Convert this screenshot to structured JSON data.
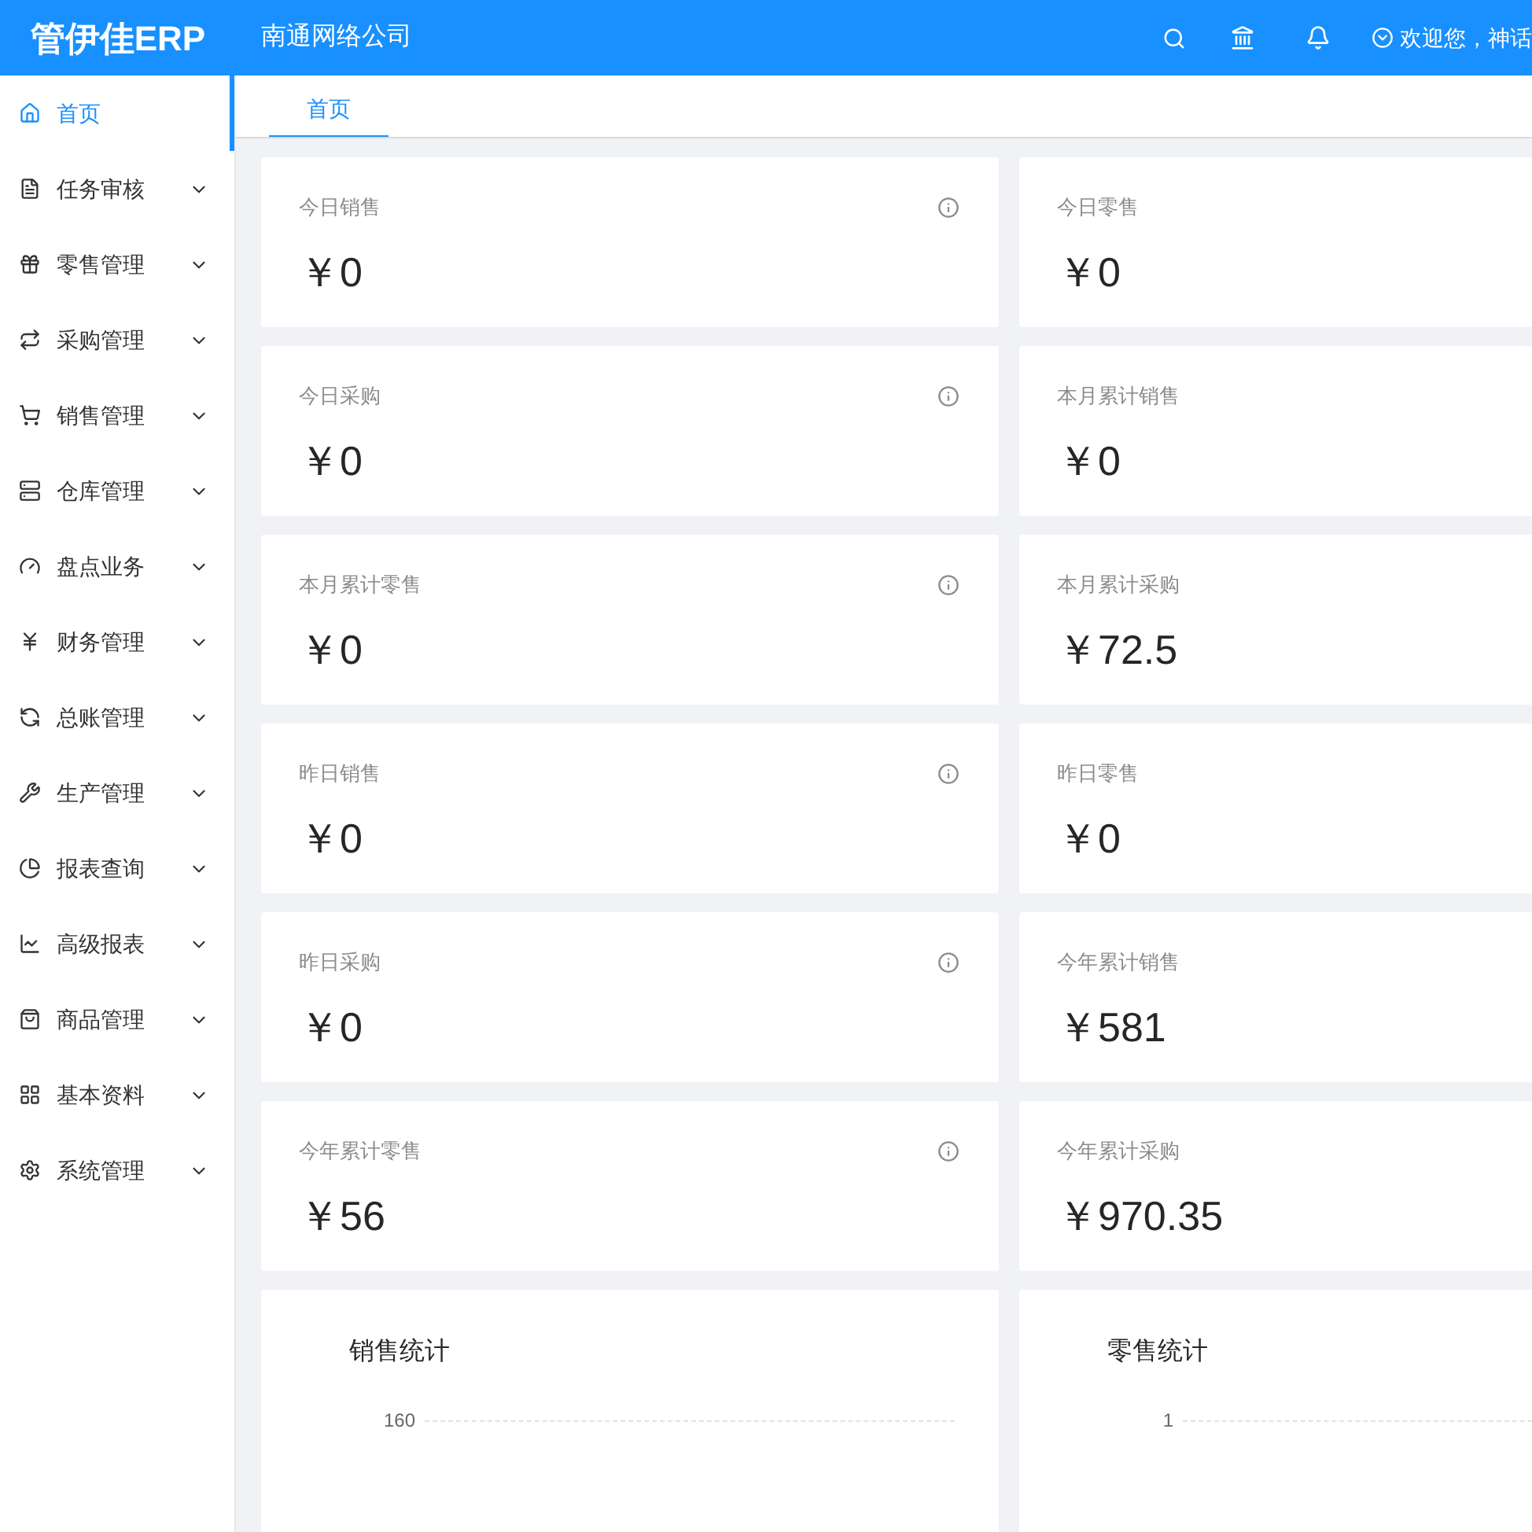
{
  "header": {
    "logo": "管伊佳ERP",
    "company": "南通网络公司",
    "welcome": "欢迎您，神话"
  },
  "sidebar": {
    "items": [
      {
        "label": "首页",
        "kind": "link",
        "selected": true
      },
      {
        "label": "任务审核",
        "kind": "group",
        "selected": false
      },
      {
        "label": "零售管理",
        "kind": "group",
        "selected": false
      },
      {
        "label": "采购管理",
        "kind": "group",
        "selected": false
      },
      {
        "label": "销售管理",
        "kind": "group",
        "selected": false
      },
      {
        "label": "仓库管理",
        "kind": "group",
        "selected": false
      },
      {
        "label": "盘点业务",
        "kind": "group",
        "selected": false
      },
      {
        "label": "财务管理",
        "kind": "group",
        "selected": false
      },
      {
        "label": "总账管理",
        "kind": "group",
        "selected": false
      },
      {
        "label": "生产管理",
        "kind": "group",
        "selected": false
      },
      {
        "label": "报表查询",
        "kind": "group",
        "selected": false
      },
      {
        "label": "高级报表",
        "kind": "group",
        "selected": false
      },
      {
        "label": "商品管理",
        "kind": "group",
        "selected": false
      },
      {
        "label": "基本资料",
        "kind": "group",
        "selected": false
      },
      {
        "label": "系统管理",
        "kind": "group",
        "selected": false
      }
    ]
  },
  "tabs": [
    {
      "label": "首页",
      "selected": true
    }
  ],
  "stats": [
    {
      "label": "今日销售",
      "value": "￥0",
      "info": true
    },
    {
      "label": "今日零售",
      "value": "￥0",
      "info": false
    },
    {
      "label": "今日采购",
      "value": "￥0",
      "info": true
    },
    {
      "label": "本月累计销售",
      "value": "￥0",
      "info": false
    },
    {
      "label": "本月累计零售",
      "value": "￥0",
      "info": true
    },
    {
      "label": "本月累计采购",
      "value": "￥72.5",
      "info": false
    },
    {
      "label": "昨日销售",
      "value": "￥0",
      "info": true
    },
    {
      "label": "昨日零售",
      "value": "￥0",
      "info": false
    },
    {
      "label": "昨日采购",
      "value": "￥0",
      "info": true
    },
    {
      "label": "今年累计销售",
      "value": "￥581",
      "info": false
    },
    {
      "label": "今年累计零售",
      "value": "￥56",
      "info": true
    },
    {
      "label": "今年累计采购",
      "value": "￥970.35",
      "info": false
    }
  ],
  "charts": [
    {
      "title": "销售统计",
      "tick": "160"
    },
    {
      "title": "零售统计",
      "tick": "1"
    }
  ]
}
